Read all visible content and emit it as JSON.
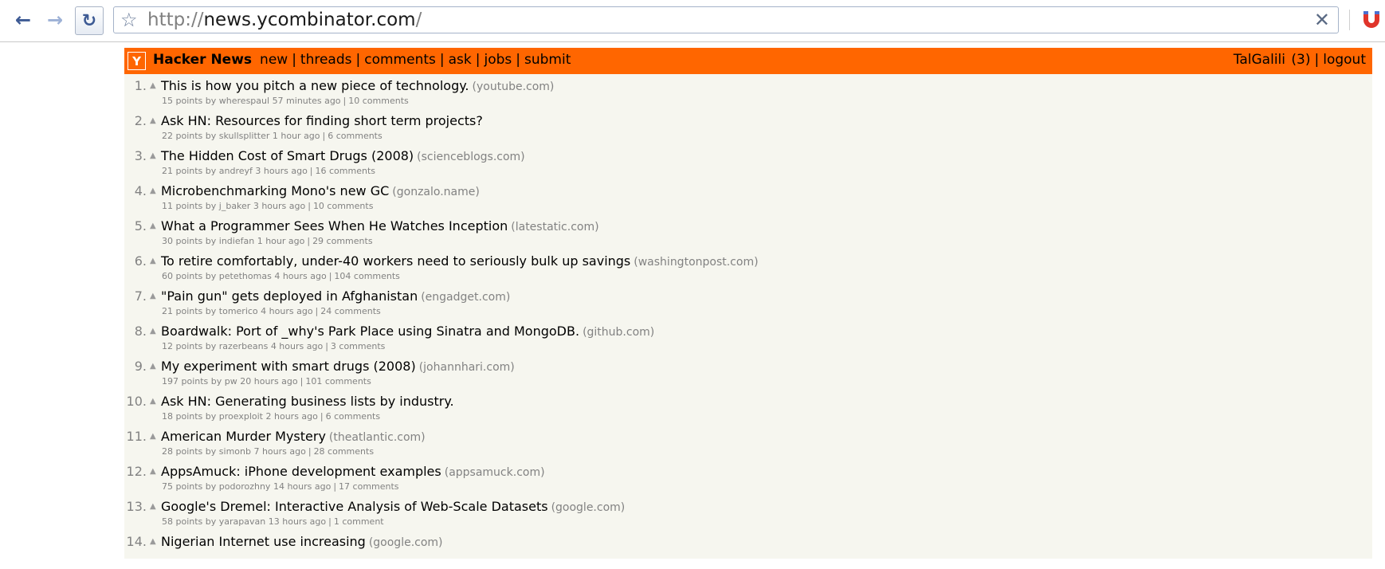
{
  "browser": {
    "url_scheme": "http://",
    "url_host": "news.ycombinator.com",
    "url_path": "/",
    "icons": {
      "back": "back-arrow-icon",
      "forward": "forward-arrow-icon",
      "reload": "reload-icon",
      "bookmark": "star-icon",
      "clear": "close-icon",
      "extension": "magnet-icon"
    }
  },
  "header": {
    "logo": "Y",
    "brand": "Hacker News",
    "nav": [
      "new",
      "threads",
      "comments",
      "ask",
      "jobs",
      "submit"
    ],
    "separator": "|",
    "user": "TalGalili",
    "karma": "(3)",
    "logout": "logout",
    "color": "#ff6600"
  },
  "stories": [
    {
      "rank": "1.",
      "title": "This is how you pitch a new piece of technology.",
      "domain": "(youtube.com)",
      "points": "15 points",
      "by": "by",
      "user": "wherespaul",
      "age": "57 minutes ago",
      "comments": "10 comments"
    },
    {
      "rank": "2.",
      "title": "Ask HN: Resources for finding short term projects?",
      "domain": "",
      "points": "22 points",
      "by": "by",
      "user": "skullsplitter",
      "age": "1 hour ago",
      "comments": "6 comments"
    },
    {
      "rank": "3.",
      "title": "The Hidden Cost of Smart Drugs (2008)",
      "domain": "(scienceblogs.com)",
      "points": "21 points",
      "by": "by",
      "user": "andreyf",
      "age": "3 hours ago",
      "comments": "16 comments"
    },
    {
      "rank": "4.",
      "title": "Microbenchmarking Mono's new GC",
      "domain": "(gonzalo.name)",
      "points": "11 points",
      "by": "by",
      "user": "j_baker",
      "age": "3 hours ago",
      "comments": "10 comments"
    },
    {
      "rank": "5.",
      "title": "What a Programmer Sees When He Watches Inception",
      "domain": "(latestatic.com)",
      "points": "30 points",
      "by": "by",
      "user": "indiefan",
      "age": "1 hour ago",
      "comments": "29 comments"
    },
    {
      "rank": "6.",
      "title": "To retire comfortably, under-40 workers need to seriously bulk up savings",
      "domain": "(washingtonpost.com)",
      "points": "60 points",
      "by": "by",
      "user": "petethomas",
      "age": "4 hours ago",
      "comments": "104 comments"
    },
    {
      "rank": "7.",
      "title": "\"Pain gun\" gets deployed in Afghanistan",
      "domain": "(engadget.com)",
      "points": "21 points",
      "by": "by",
      "user": "tomerico",
      "age": "4 hours ago",
      "comments": "24 comments"
    },
    {
      "rank": "8.",
      "title": "Boardwalk: Port of _why's Park Place using Sinatra and MongoDB.",
      "domain": "(github.com)",
      "points": "12 points",
      "by": "by",
      "user": "razerbeans",
      "age": "4 hours ago",
      "comments": "3 comments"
    },
    {
      "rank": "9.",
      "title": "My experiment with smart drugs (2008)",
      "domain": "(johannhari.com)",
      "points": "197 points",
      "by": "by",
      "user": "pw",
      "age": "20 hours ago",
      "comments": "101 comments"
    },
    {
      "rank": "10.",
      "title": "Ask HN: Generating business lists by industry.",
      "domain": "",
      "points": "18 points",
      "by": "by",
      "user": "proexploit",
      "age": "2 hours ago",
      "comments": "6 comments"
    },
    {
      "rank": "11.",
      "title": "American Murder Mystery",
      "domain": "(theatlantic.com)",
      "points": "28 points",
      "by": "by",
      "user": "simonb",
      "age": "7 hours ago",
      "comments": "28 comments"
    },
    {
      "rank": "12.",
      "title": "AppsAmuck: iPhone development examples",
      "domain": "(appsamuck.com)",
      "points": "75 points",
      "by": "by",
      "user": "podorozhny",
      "age": "14 hours ago",
      "comments": "17 comments"
    },
    {
      "rank": "13.",
      "title": "Google's Dremel: Interactive Analysis of Web-Scale Datasets",
      "domain": "(google.com)",
      "points": "58 points",
      "by": "by",
      "user": "yarapavan",
      "age": "13 hours ago",
      "comments": "1 comment"
    },
    {
      "rank": "14.",
      "title": "Nigerian Internet use increasing",
      "domain": "(google.com)",
      "points": "",
      "by": "",
      "user": "",
      "age": "",
      "comments": ""
    }
  ]
}
